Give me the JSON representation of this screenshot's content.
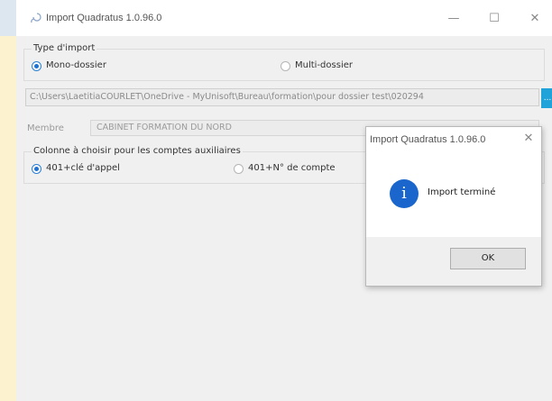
{
  "window": {
    "title": "Import Quadratus 1.0.96.0",
    "minimize_glyph": "—",
    "maximize_glyph": "☐",
    "close_glyph": "✕",
    "icon": "app-logo-icon"
  },
  "type_import": {
    "legend": "Type d'import",
    "options": [
      {
        "label": "Mono-dossier",
        "selected": true
      },
      {
        "label": "Multi-dossier",
        "selected": false
      }
    ]
  },
  "path": {
    "value": "C:\\Users\\LaetitiaCOURLET\\OneDrive - MyUnisoft\\Bureau\\formation\\pour dossier test\\020294",
    "browse_label": "..."
  },
  "membre": {
    "label": "Membre",
    "value": "CABINET FORMATION DU NORD",
    "arrow": "▾"
  },
  "colonne": {
    "legend": "Colonne à choisir pour les comptes auxiliaires",
    "options": [
      {
        "label": "401+clé d'appel",
        "selected": true
      },
      {
        "label": "401+N° de compte",
        "selected": false
      }
    ]
  },
  "dialog": {
    "title": "Import Quadratus 1.0.96.0",
    "close_glyph": "✕",
    "icon_glyph": "i",
    "message": "Import terminé",
    "ok_label": "OK"
  },
  "colors": {
    "accent": "#1e73d2",
    "browse": "#1fa3d8",
    "left_strip": "#fdf2d0",
    "info_icon": "#1a66cc"
  }
}
